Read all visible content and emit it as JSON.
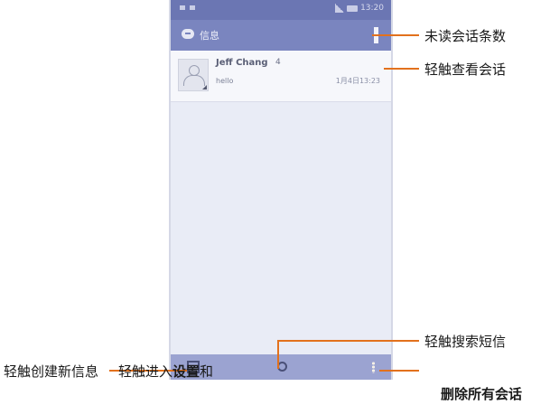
{
  "status_bar": {
    "time": "13:20"
  },
  "action_bar": {
    "title": "信息"
  },
  "conversation": {
    "name": "Jeff Chang",
    "count": "4",
    "snippet": "hello",
    "time": "1月4日13:23"
  },
  "callouts": {
    "unread_count": "未读会话条数",
    "tap_view": "轻触查看会话",
    "tap_search": "轻触搜索短信",
    "tap_new": "轻触创建新信息",
    "tap_settings_prefix": "轻触进入",
    "tap_settings_bold": "设置",
    "tap_settings_suffix": "和",
    "delete_all": "删除所有会话"
  },
  "colors": {
    "callout_line": "#e2711d",
    "action_bar": "#7a85bf",
    "bottom_bar": "#9ba3d1"
  }
}
